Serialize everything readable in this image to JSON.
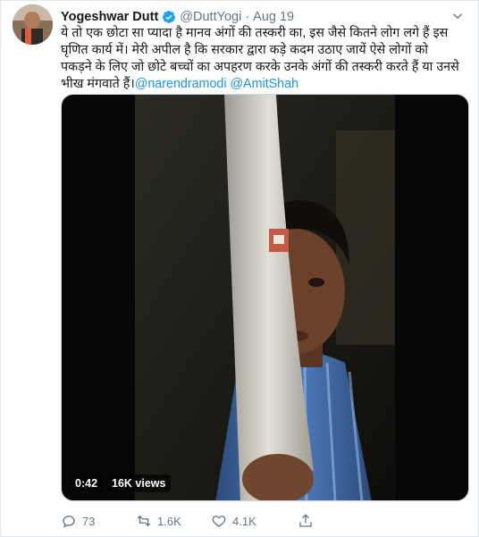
{
  "author": {
    "name": "Yogeshwar Dutt",
    "handle": "@DuttYogi",
    "separator": "·",
    "date": "Aug 19"
  },
  "tweet": {
    "lines": [
      "ये तो एक छोटा सा प्यादा है मानव अंगों की तस्करी का, इस जैसे कितने लोग लगे हैं इस",
      "घृणित कार्य में। मेरी अपील है कि सरकार द्वारा कड़े कदम उठाए जायें ऐसे लोगों को",
      "पकड़ने के लिए जो छोटे बच्चों का अपहरण करके उनके अंगों की तस्करी करते हैं या उनसे",
      "भीख मंगवाते हैं।"
    ],
    "mention1": "@narendramodi",
    "mention2": "@AmitShah"
  },
  "video": {
    "duration": "0:42",
    "views": "16K views"
  },
  "actions": {
    "replies": "73",
    "retweets": "1.6K",
    "likes": "4.1K"
  },
  "colors": {
    "link": "#1b95e0",
    "muted": "#657786",
    "verified": "#1da1f2"
  },
  "icons": [
    "verified-icon",
    "caret-down-icon",
    "reply-icon",
    "retweet-icon",
    "like-icon",
    "share-icon"
  ]
}
